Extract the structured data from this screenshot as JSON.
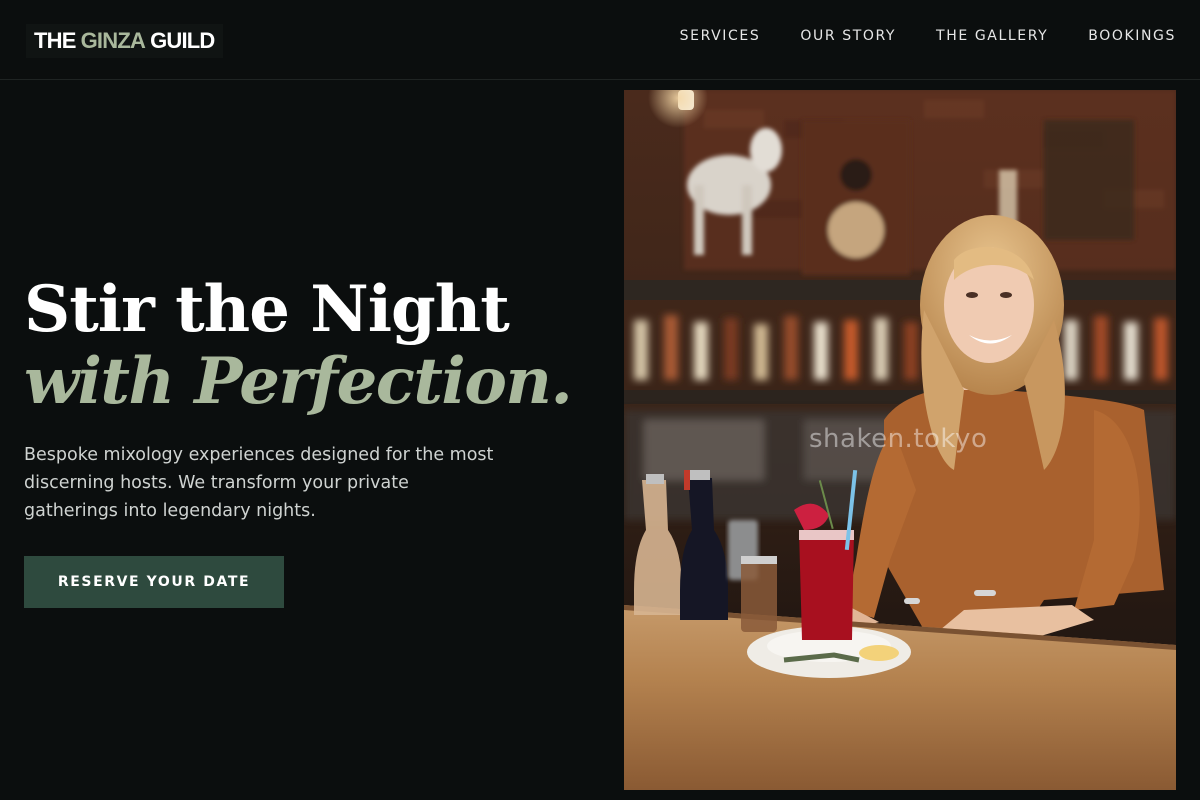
{
  "brand": {
    "part1": "THE",
    "part2": "GINZA",
    "part3": "GUILD",
    "accent_color": "#a9b89c"
  },
  "nav": {
    "items": [
      {
        "label": "SERVICES"
      },
      {
        "label": "OUR STORY"
      },
      {
        "label": "THE GALLERY"
      },
      {
        "label": "BOOKINGS"
      }
    ]
  },
  "hero": {
    "title_line1": "Stir the Night",
    "title_line2": "with Perfection.",
    "description": "Bespoke mixology experiences designed for the most discerning hosts. We transform your private gatherings into legendary nights.",
    "cta_label": "RESERVE YOUR DATE",
    "cta_color": "#2e4a3e"
  },
  "photo": {
    "watermark": "shaken.tokyo",
    "subject": "bartender serving a red cocktail at a bar"
  }
}
